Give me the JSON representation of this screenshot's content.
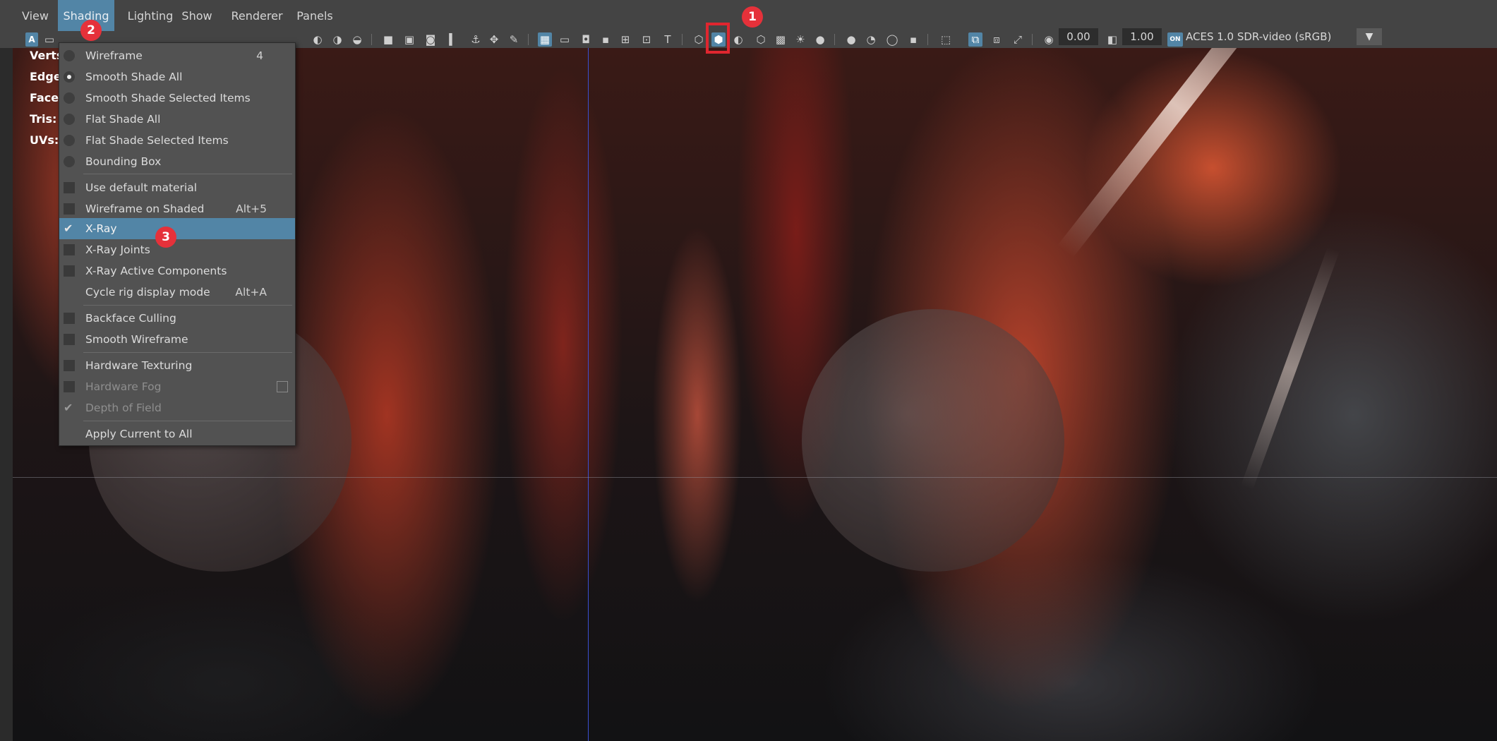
{
  "menubar": {
    "items": [
      {
        "label": "View"
      },
      {
        "label": "Shading"
      },
      {
        "label": "Lighting"
      },
      {
        "label": "Show"
      },
      {
        "label": "Renderer"
      },
      {
        "label": "Panels"
      }
    ]
  },
  "toolbar": {
    "exposure_value": "0.00",
    "gamma_value": "1.00",
    "color_space": "ACES 1.0 SDR-video (sRGB)",
    "color_space_badge": "ON",
    "icons": [
      "camera-icon",
      "grid-icon",
      "wireframe-icon",
      "smooth-shade-icon",
      "xray-icon",
      "textures-icon",
      "lights-icon",
      "isolate-icon",
      "exposure-icon",
      "gamma-icon"
    ]
  },
  "hud": {
    "verts_label": "Verts",
    "edges_label": "Edge",
    "faces_label": "Face:",
    "tris_label": "Tris:",
    "uvs_label": "UVs:"
  },
  "shading_menu": {
    "items": [
      {
        "label": "Wireframe",
        "hotkey": "4",
        "type": "radio",
        "selected": false
      },
      {
        "label": "Smooth Shade All",
        "type": "radio",
        "selected": true
      },
      {
        "label": "Smooth Shade Selected Items",
        "type": "radio",
        "selected": false
      },
      {
        "label": "Flat Shade All",
        "type": "radio",
        "selected": false
      },
      {
        "label": "Flat Shade Selected Items",
        "type": "radio",
        "selected": false
      },
      {
        "label": "Bounding Box",
        "type": "radio",
        "selected": false
      },
      {
        "label": "Use default material",
        "type": "check",
        "checked": false
      },
      {
        "label": "Wireframe on Shaded",
        "hotkey": "Alt+5",
        "type": "check",
        "checked": false
      },
      {
        "label": "X-Ray",
        "type": "check",
        "checked": true,
        "highlighted": true
      },
      {
        "label": "X-Ray Joints",
        "type": "check",
        "checked": false
      },
      {
        "label": "X-Ray Active Components",
        "type": "check",
        "checked": false
      },
      {
        "label": "Cycle rig display mode",
        "hotkey": "Alt+A",
        "type": "none"
      },
      {
        "label": "Backface Culling",
        "type": "check",
        "checked": false
      },
      {
        "label": "Smooth Wireframe",
        "type": "check",
        "checked": false
      },
      {
        "label": "Hardware Texturing",
        "type": "check",
        "checked": false
      },
      {
        "label": "Hardware Fog",
        "type": "check",
        "checked": false,
        "disabled": true
      },
      {
        "label": "Depth of Field",
        "type": "check",
        "checked": true,
        "disabled": true
      },
      {
        "label": "Apply Current to All",
        "type": "none"
      }
    ]
  },
  "annotations": {
    "badge_1": "1",
    "badge_2": "2",
    "badge_3": "3",
    "accent_color": "#e5313a",
    "highlight_color": "#5285a6"
  }
}
